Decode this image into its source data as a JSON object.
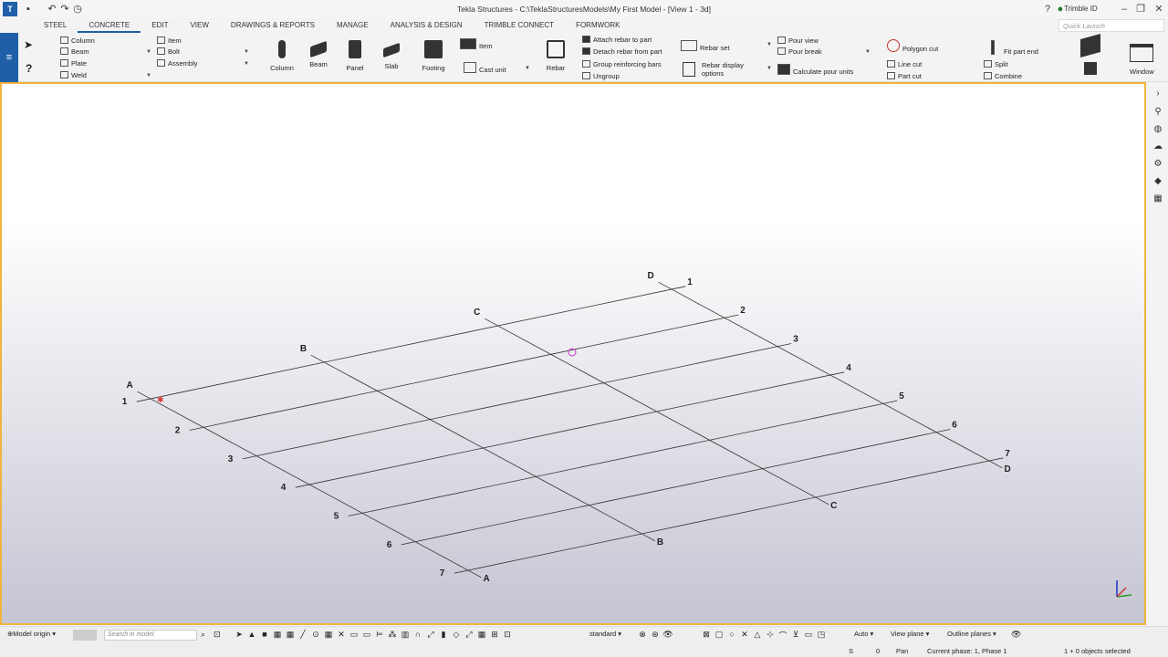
{
  "app": {
    "title": "Tekla Structures - C:\\TeklaStructuresModels\\My First Model - [View 1 - 3d]",
    "trimble_id": "Trimble ID",
    "quick_launch_placeholder": "Quick Launch"
  },
  "tabs": [
    "STEEL",
    "CONCRETE",
    "EDIT",
    "VIEW",
    "DRAWINGS & REPORTS",
    "MANAGE",
    "ANALYSIS & DESIGN",
    "TRIMBLE CONNECT",
    "FORMWORK"
  ],
  "active_tab": "CONCRETE",
  "ribbon": {
    "steel_list": [
      "Column",
      "Beam",
      "Plate",
      "Weld"
    ],
    "item_list": [
      "Item",
      "Bolt",
      "Assembly"
    ],
    "big_buttons": [
      "Column",
      "Beam",
      "Panel",
      "Slab",
      "Footing"
    ],
    "item2": "Item",
    "cast_unit": "Cast unit",
    "rebar": "Rebar",
    "rebar_ops": [
      "Attach rebar to part",
      "Detach rebar from part",
      "Group reinforcing bars",
      "Ungroup"
    ],
    "rebar_set": "Rebar set",
    "rebar_display": "Rebar display options",
    "pour_view": "Pour view",
    "pour_break": "Pour break",
    "calc_pour": "Calculate pour units",
    "polygon_cut": "Polygon cut",
    "line_cut": "Line cut",
    "part_cut": "Part cut",
    "fit_part_end": "Fit part end",
    "split": "Split",
    "combine": "Combine",
    "window": "Window"
  },
  "status": {
    "model_origin": "Model origin",
    "search_placeholder": "Search in model",
    "standard": "standard",
    "auto": "Auto",
    "view_plane": "View plane",
    "outline_planes": "Outline planes",
    "snap_s": "S",
    "snap_value": "0",
    "pan": "Pan",
    "current_phase": "Current phase: 1, Phase 1",
    "selection": "1 + 0 objects selected"
  },
  "grid": {
    "letter_labels": [
      "A",
      "B",
      "C",
      "D"
    ],
    "number_labels": [
      "1",
      "2",
      "3",
      "4",
      "5",
      "6",
      "7"
    ]
  },
  "colors": {
    "accent": "#1f5fa8",
    "viewport_border": "#f0b43c",
    "grid_line": "#333333"
  }
}
